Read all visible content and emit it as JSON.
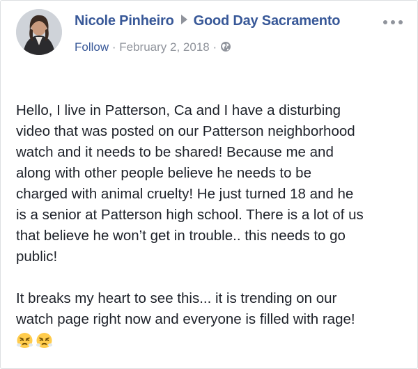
{
  "post": {
    "author": "Nicole Pinheiro",
    "group": "Good Day Sacramento",
    "follow_label": "Follow",
    "separator": "·",
    "date": "February 2, 2018",
    "privacy_icon": "globe-icon",
    "more_icon": "more-options-icon",
    "paragraph_1_lines": [
      "Hello, I live in Patterson, Ca and I have a disturbing",
      "video that was posted on our Patterson neighborhood",
      "watch and it needs to be shared! Because me and",
      "along with other people believe he needs to be",
      "charged with animal cruelty! He just turned 18 and he",
      "is a senior at Patterson high school. There is a lot of us",
      "that believe he won’t get in trouble.. this needs to go",
      "public!"
    ],
    "paragraph_2_lines": [
      "It breaks my heart to see this... it is trending on our",
      "watch page right now and everyone is filled with rage!"
    ],
    "emojis": [
      "😤",
      "😤"
    ]
  },
  "colors": {
    "link": "#385898",
    "meta": "#90949c",
    "text": "#1d2129",
    "border": "#dddfe2"
  }
}
